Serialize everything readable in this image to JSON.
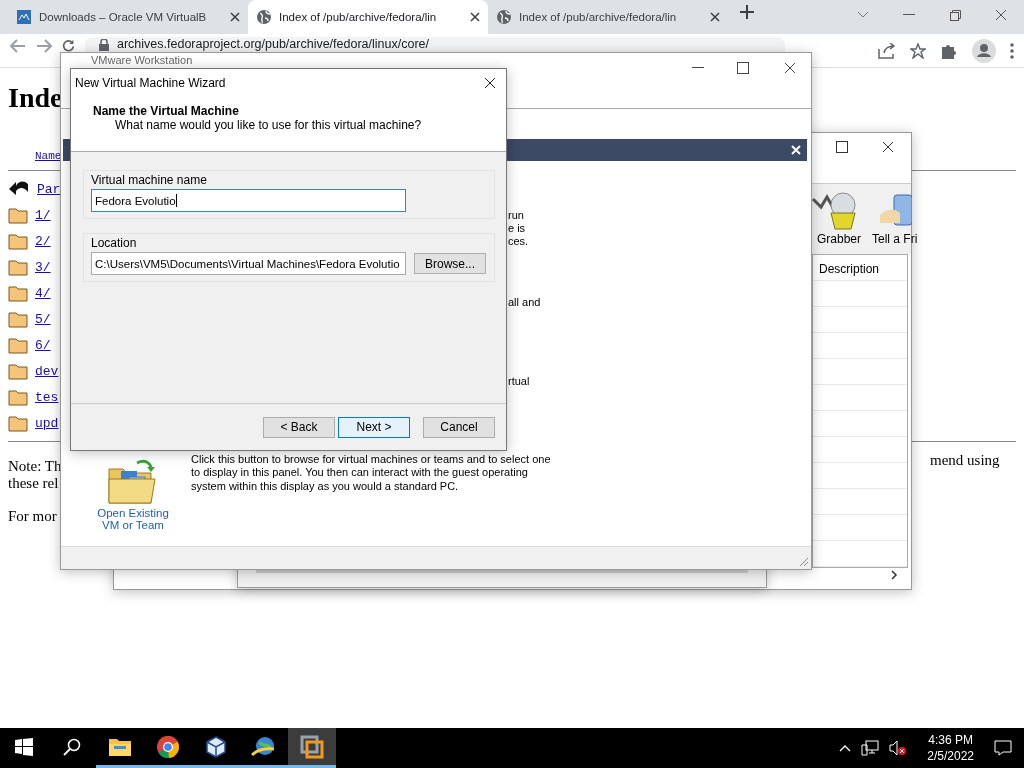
{
  "browser": {
    "tabs": [
      {
        "title": "Downloads – Oracle VM VirtualB",
        "kind": "vbox",
        "selected": false
      },
      {
        "title": "Index of /pub/archive/fedora/lin",
        "kind": "globe",
        "selected": true
      },
      {
        "title": "Index of /pub/archive/fedora/lin",
        "kind": "globe",
        "selected": false
      }
    ],
    "address": "archives.fedoraproject.org/pub/archive/fedora/linux/core/"
  },
  "page": {
    "heading": "Inde",
    "sort_link": "Name",
    "entries": [
      {
        "kind": "parent",
        "name": "Par"
      },
      {
        "kind": "folder",
        "name": "1/"
      },
      {
        "kind": "folder",
        "name": "2/"
      },
      {
        "kind": "folder",
        "name": "3/"
      },
      {
        "kind": "folder",
        "name": "4/"
      },
      {
        "kind": "folder",
        "name": "5/"
      },
      {
        "kind": "folder",
        "name": "6/"
      },
      {
        "kind": "folder",
        "name": "dev"
      },
      {
        "kind": "folder",
        "name": "tes"
      },
      {
        "kind": "folder",
        "name": "upd"
      }
    ],
    "note": [
      "Note: Th",
      "these rel"
    ],
    "note_end": "mend using",
    "more": "For mor"
  },
  "back_window": {
    "toolbar": [
      {
        "label": "Grabber",
        "kind": "grabber"
      },
      {
        "label": "Tell a Fri",
        "kind": "tell"
      }
    ],
    "column": "Description"
  },
  "vmware": {
    "title": "VMware Workstation",
    "panel_text": [
      "run",
      "e is",
      "ces.",
      "all and",
      "rtual"
    ],
    "open_button": {
      "label": "Open Existing VM or Team",
      "description": "Click this button to browse for virtual machines or teams and to select one to display in this panel. You then can interact with the guest operating system within this display as you would a standard PC."
    }
  },
  "wizard": {
    "title": "New Virtual Machine Wizard",
    "heading": "Name the Virtual Machine",
    "subheading": "What name would you like to use for this virtual machine?",
    "fields": [
      {
        "label": "Virtual machine name",
        "value": "Fedora Evolutio",
        "focused": true
      },
      {
        "label": "Location",
        "value": "C:\\Users\\VM5\\Documents\\Virtual Machines\\Fedora Evolutio",
        "focused": false,
        "button": "Browse..."
      }
    ],
    "buttons": [
      {
        "label": "< Back",
        "default": false
      },
      {
        "label": "Next >",
        "default": true
      },
      {
        "label": "Cancel",
        "default": false
      }
    ]
  },
  "taskbar": {
    "apps": [
      {
        "kind": "explorer",
        "selected": false
      },
      {
        "kind": "chrome",
        "selected": false
      },
      {
        "kind": "vbox",
        "selected": false
      },
      {
        "kind": "globe",
        "selected": false
      },
      {
        "kind": "vmware",
        "selected": true
      }
    ],
    "time": "4:36 PM",
    "date": "2/5/2022"
  }
}
